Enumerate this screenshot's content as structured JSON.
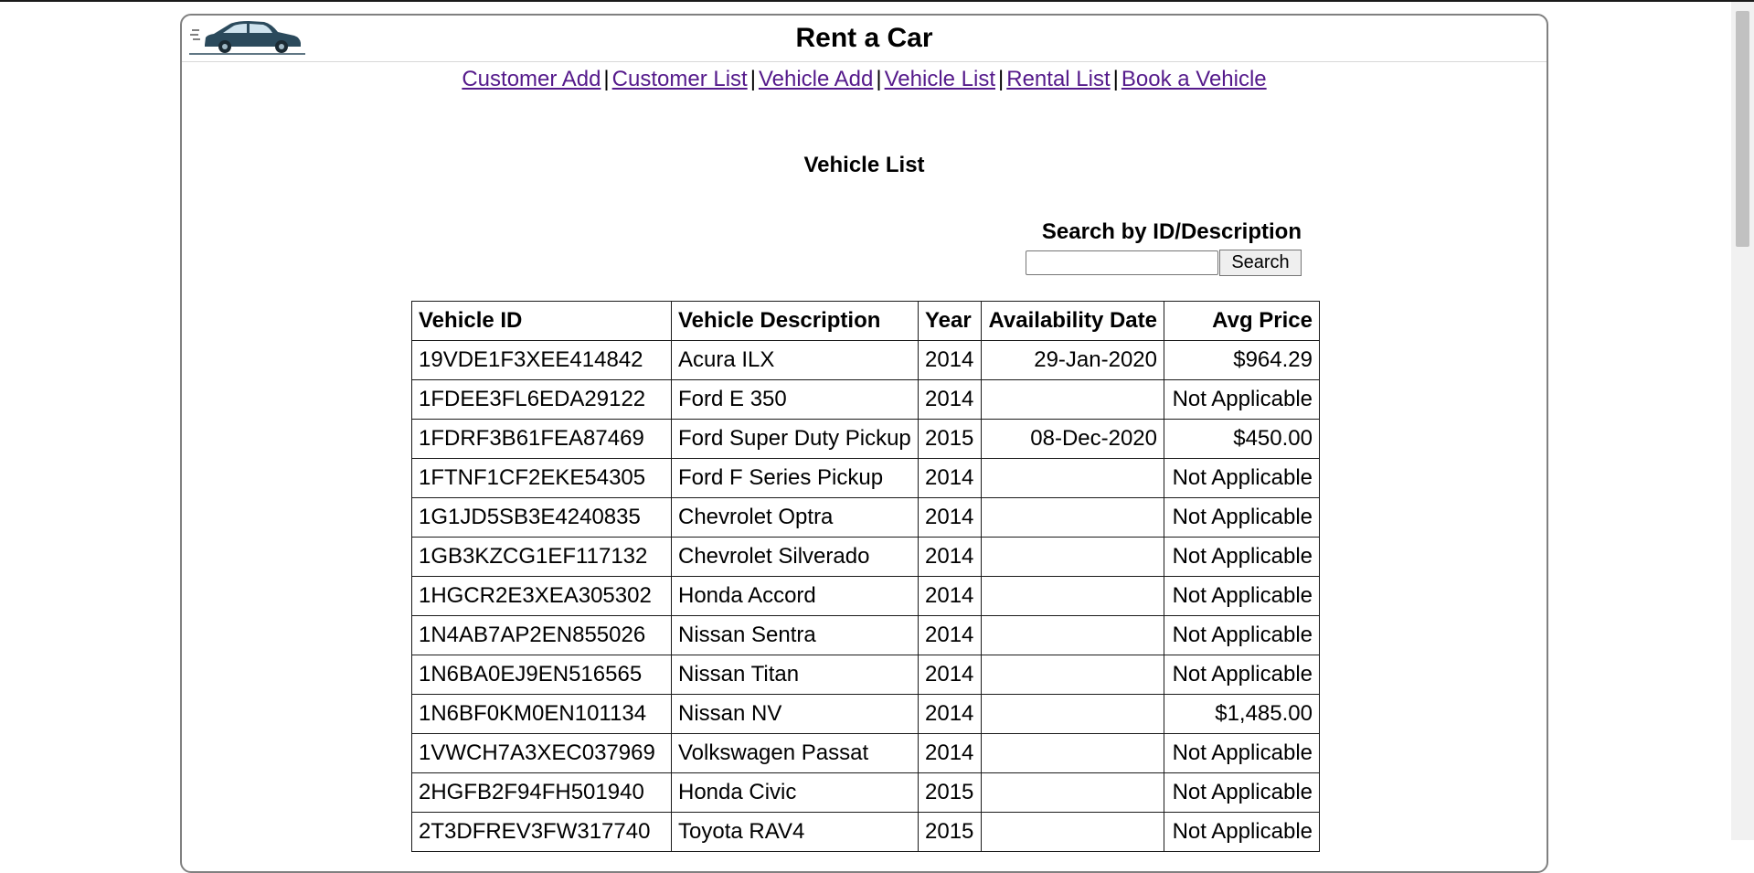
{
  "app": {
    "title": "Rent a Car",
    "logo_icon": "car-icon"
  },
  "nav": {
    "items": [
      {
        "label": "Customer Add"
      },
      {
        "label": "Customer List"
      },
      {
        "label": "Vehicle Add"
      },
      {
        "label": "Vehicle List"
      },
      {
        "label": "Rental List"
      },
      {
        "label": "Book a Vehicle"
      }
    ],
    "separator": "|",
    "link_color": "#551a8b"
  },
  "page": {
    "title": "Vehicle List"
  },
  "search": {
    "label": "Search by ID/Description",
    "value": "",
    "placeholder": "",
    "button_label": "Search"
  },
  "table": {
    "headers": [
      "Vehicle ID",
      "Vehicle Description",
      "Year",
      "Availability Date",
      "Avg Price"
    ],
    "rows": [
      [
        "19VDE1F3XEE414842",
        "Acura ILX",
        "2014",
        "29-Jan-2020",
        "$964.29"
      ],
      [
        "1FDEE3FL6EDA29122",
        "Ford E 350",
        "2014",
        "",
        "Not Applicable"
      ],
      [
        "1FDRF3B61FEA87469",
        "Ford Super Duty Pickup",
        "2015",
        "08-Dec-2020",
        "$450.00"
      ],
      [
        "1FTNF1CF2EKE54305",
        "Ford F Series Pickup",
        "2014",
        "",
        "Not Applicable"
      ],
      [
        "1G1JD5SB3E4240835",
        "Chevrolet Optra",
        "2014",
        "",
        "Not Applicable"
      ],
      [
        "1GB3KZCG1EF117132",
        "Chevrolet Silverado",
        "2014",
        "",
        "Not Applicable"
      ],
      [
        "1HGCR2E3XEA305302",
        "Honda Accord",
        "2014",
        "",
        "Not Applicable"
      ],
      [
        "1N4AB7AP2EN855026",
        "Nissan Sentra",
        "2014",
        "",
        "Not Applicable"
      ],
      [
        "1N6BA0EJ9EN516565",
        "Nissan Titan",
        "2014",
        "",
        "Not Applicable"
      ],
      [
        "1N6BF0KM0EN101134",
        "Nissan NV",
        "2014",
        "",
        "$1,485.00"
      ],
      [
        "1VWCH7A3XEC037969",
        "Volkswagen Passat",
        "2014",
        "",
        "Not Applicable"
      ],
      [
        "2HGFB2F94FH501940",
        "Honda Civic",
        "2015",
        "",
        "Not Applicable"
      ],
      [
        "2T3DFREV3FW317740",
        "Toyota RAV4",
        "2015",
        "",
        "Not Applicable"
      ]
    ]
  }
}
